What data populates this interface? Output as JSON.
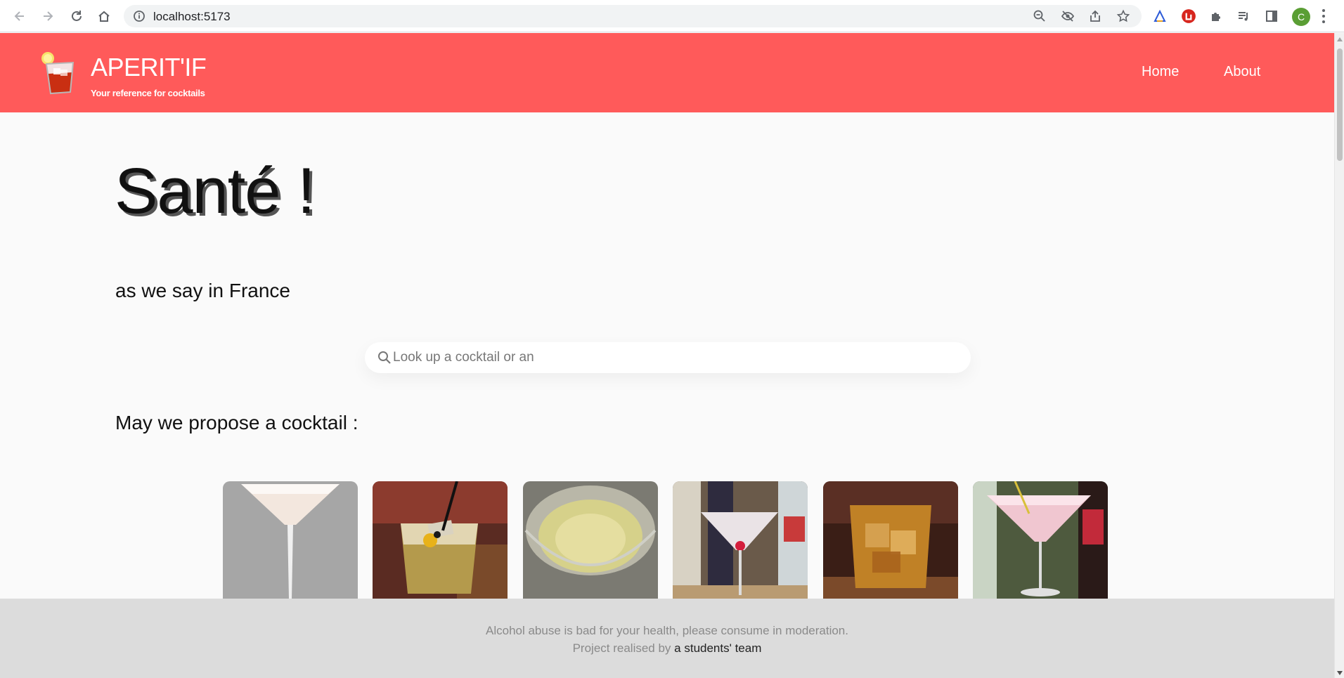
{
  "browser": {
    "url": "localhost:5173",
    "profile_initial": "C",
    "profile_color": "#5a9e34"
  },
  "header": {
    "brand_title": "APERIT'IF",
    "brand_subtitle": "Your reference for cocktails",
    "nav": [
      {
        "label": "Home"
      },
      {
        "label": "About"
      }
    ],
    "background_color": "#ff5a5a"
  },
  "main": {
    "hero_title": "Santé !",
    "hero_subtitle": "as we say in France",
    "search": {
      "placeholder": "Look up a cocktail or an",
      "value": ""
    },
    "section_title": "May we propose a cocktail :",
    "cards": [
      {
        "icon": "martini-glass-image"
      },
      {
        "icon": "whiskey-sour-image"
      },
      {
        "icon": "yellow-martini-image"
      },
      {
        "icon": "cherry-martini-image"
      },
      {
        "icon": "old-fashioned-image"
      },
      {
        "icon": "pink-martini-image"
      }
    ]
  },
  "footer": {
    "line1": "Alcohol abuse is bad for your health, please consume in moderation.",
    "line2_prefix": "Project realised by ",
    "line2_link": "a students' team"
  }
}
